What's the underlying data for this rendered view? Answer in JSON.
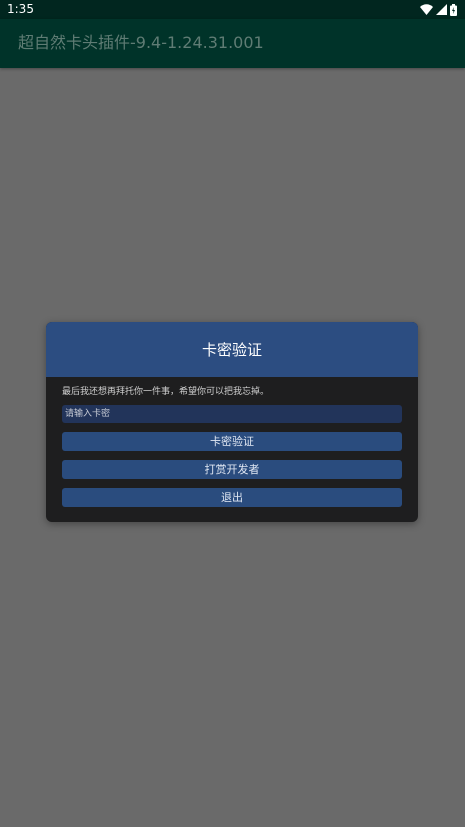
{
  "status_bar": {
    "time": "1:35",
    "icons": [
      "wifi-icon",
      "signal-icon",
      "battery-icon"
    ]
  },
  "app_bar": {
    "title": "超自然卡头插件-9.4-1.24.31.001"
  },
  "dialog": {
    "title": "卡密验证",
    "message": "最后我还想再拜托你一件事，希望你可以把我忘掉。",
    "input": {
      "value": "",
      "placeholder": "请输入卡密"
    },
    "buttons": {
      "verify": "卡密验证",
      "donate": "打赏开发者",
      "exit": "退出"
    }
  },
  "colors": {
    "status_bar_bg": "#01261f",
    "app_bar_bg": "#003329",
    "scrim": "#6a6a6a",
    "dialog_header": "#2c4d81",
    "dialog_body": "#1e1e1f",
    "button_bg": "#2a4c7e"
  }
}
